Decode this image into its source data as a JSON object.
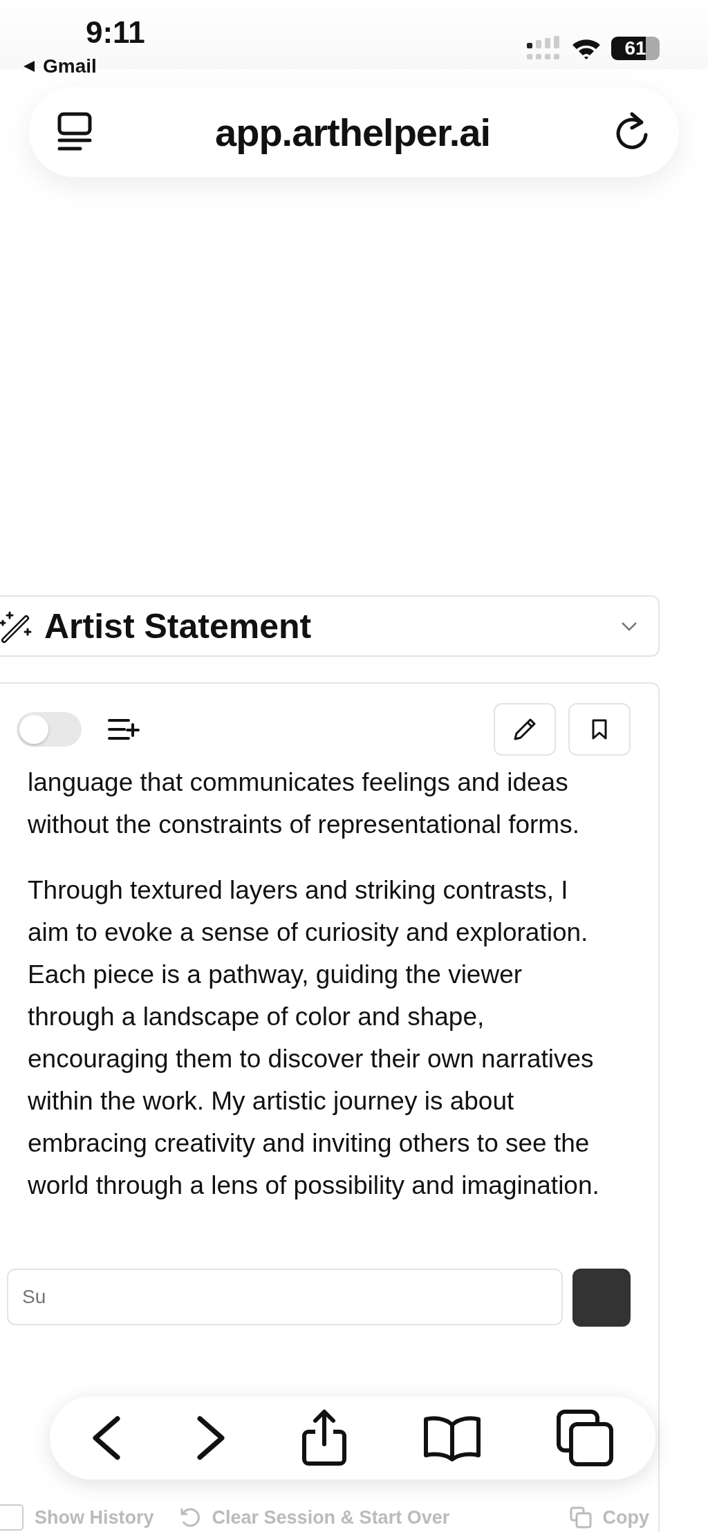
{
  "status_bar": {
    "time": "9:11",
    "back_app": "Gmail",
    "battery": "61"
  },
  "address_bar": {
    "url": "app.arthelper.ai"
  },
  "section": {
    "title": "Artist Statement"
  },
  "editor": {
    "toggle_on": false,
    "paragraphs": [
      "language that communicates feelings and ideas without the constraints of representational forms.",
      "Through textured layers and striking contrasts, I aim to evoke a sense of curiosity and exploration. Each piece is a pathway, guiding the viewer through a landscape of color and shape, encouraging them to discover their own narratives within the work. My artistic journey is about embracing creativity and inviting others to see the world through a lens of possibility and imagination."
    ]
  },
  "input": {
    "placeholder": "Su"
  },
  "footer": {
    "show_history": {
      "label": "Show History",
      "checked": false
    },
    "clear": "Clear Session & Start Over",
    "copy": "Copy"
  }
}
